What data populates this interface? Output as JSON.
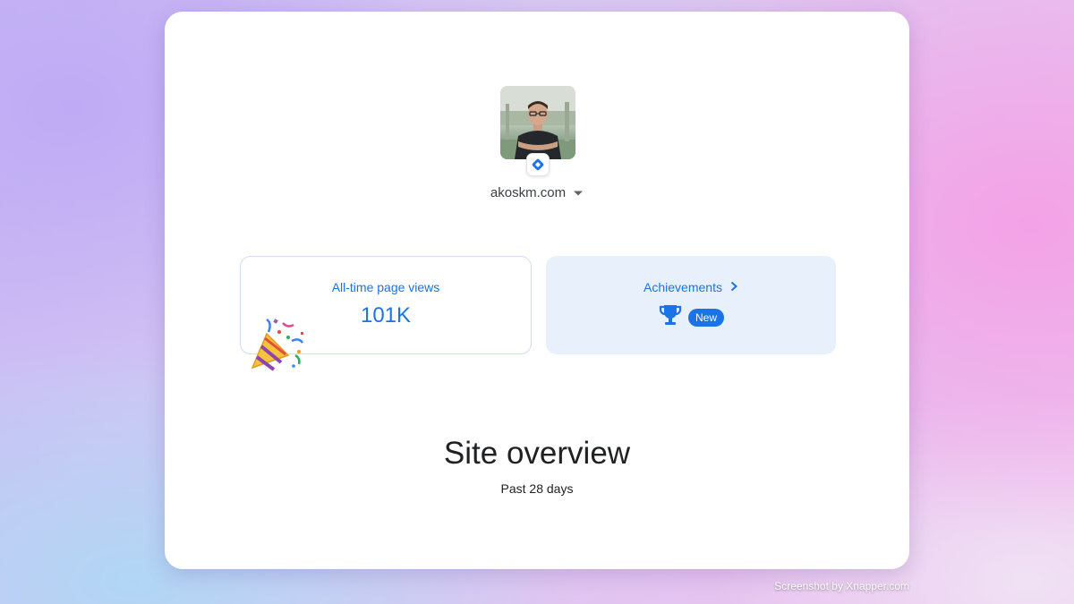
{
  "site": {
    "domain": "akoskm.com",
    "badge_icon": "search-console-diamond-icon",
    "dropdown_icon": "caret-down-icon"
  },
  "stats": {
    "label": "All-time page views",
    "value": "101K",
    "decoration_icon": "party-popper-icon"
  },
  "achievements": {
    "label": "Achievements",
    "badge": "New",
    "icon": "trophy-icon",
    "chevron_icon": "chevron-right-icon"
  },
  "overview": {
    "title": "Site overview",
    "period": "Past 28 days"
  },
  "watermark": "Screenshot by Xnapper.com",
  "colors": {
    "accent": "#1a73e8",
    "achievement_bg": "#e8f0fc",
    "card_border": "#cfddf2",
    "text": "#202124"
  }
}
